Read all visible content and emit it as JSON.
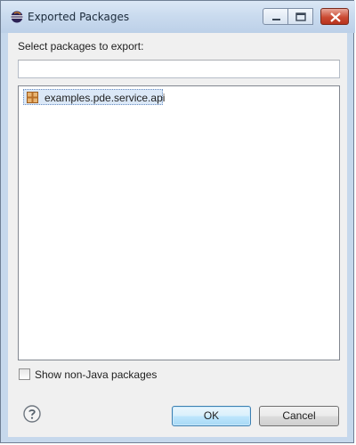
{
  "window": {
    "title": "Exported Packages",
    "icon": "eclipse-icon",
    "controls": [
      "minimize-icon",
      "maximize-icon",
      "close-icon"
    ]
  },
  "prompt": "Select packages to export:",
  "filter": {
    "value": "",
    "placeholder": ""
  },
  "packages": [
    {
      "name": "examples.pde.service.api",
      "icon": "package-icon",
      "selected": true
    }
  ],
  "options": {
    "show_non_java_label": "Show non-Java packages",
    "show_non_java_checked": false
  },
  "buttons": {
    "ok": "OK",
    "cancel": "Cancel",
    "help_icon": "help-icon"
  },
  "colors": {
    "selection": "#dbe8f7",
    "default_button_border": "#3c7fb1",
    "close_button": "#cb4b33"
  }
}
